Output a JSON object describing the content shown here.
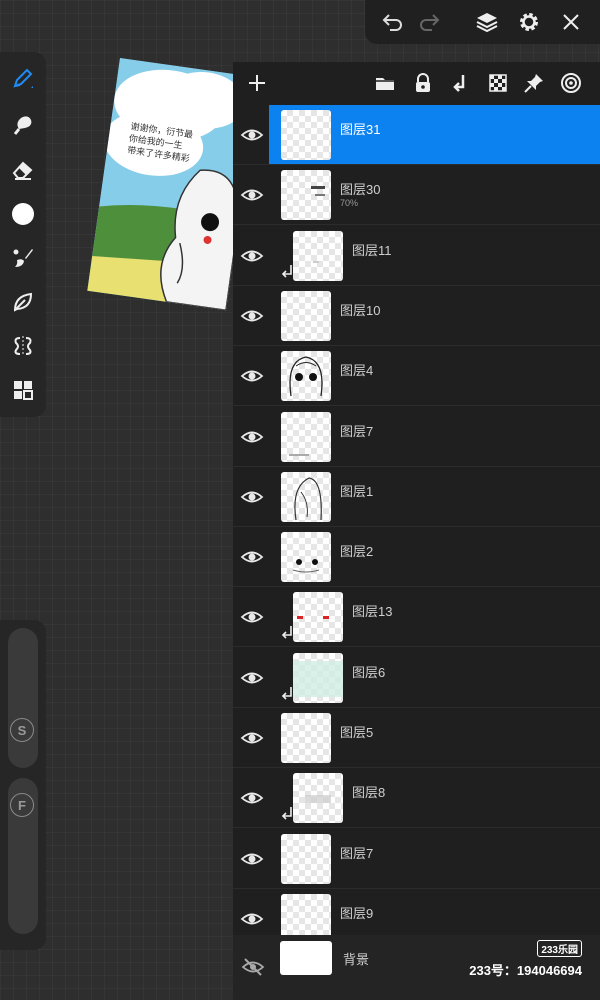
{
  "canvas": {
    "bubble_lines": [
      "谢谢你，衍节最",
      "你给我的一生",
      "带来了许多精彩"
    ]
  },
  "layers": [
    {
      "name": "图层31",
      "selected": true,
      "clipped": false,
      "opacity": ""
    },
    {
      "name": "图层30",
      "selected": false,
      "clipped": false,
      "opacity": "70%"
    },
    {
      "name": "图层11",
      "selected": false,
      "clipped": true,
      "opacity": ""
    },
    {
      "name": "图层10",
      "selected": false,
      "clipped": false,
      "opacity": ""
    },
    {
      "name": "图层4",
      "selected": false,
      "clipped": false,
      "opacity": ""
    },
    {
      "name": "图层7",
      "selected": false,
      "clipped": false,
      "opacity": ""
    },
    {
      "name": "图层1",
      "selected": false,
      "clipped": false,
      "opacity": ""
    },
    {
      "name": "图层2",
      "selected": false,
      "clipped": false,
      "opacity": ""
    },
    {
      "name": "图层13",
      "selected": false,
      "clipped": true,
      "opacity": ""
    },
    {
      "name": "图层6",
      "selected": false,
      "clipped": true,
      "opacity": ""
    },
    {
      "name": "图层5",
      "selected": false,
      "clipped": false,
      "opacity": ""
    },
    {
      "name": "图层8",
      "selected": false,
      "clipped": true,
      "opacity": ""
    },
    {
      "name": "图层7",
      "selected": false,
      "clipped": false,
      "opacity": ""
    },
    {
      "name": "图层9",
      "selected": false,
      "clipped": false,
      "opacity": ""
    }
  ],
  "background_layer": {
    "name": "背景",
    "visible": false
  },
  "watermark": {
    "logo": "233乐园",
    "id_text": "233号：194046694"
  },
  "toolbar": {
    "size_slider_label": "S",
    "flow_slider_label": "F"
  },
  "colors": {
    "accent": "#0b82f0",
    "panel": "#1f1f1f"
  },
  "icons": {
    "topbar": [
      "undo-icon",
      "redo-icon",
      "layers-icon",
      "settings-gear-icon",
      "close-icon"
    ],
    "panel_header": [
      "add-layer-icon",
      "folder-icon",
      "lock-icon",
      "merge-down-icon",
      "checkerboard-icon",
      "pin-icon",
      "target-icon"
    ],
    "tools": [
      "pen-icon",
      "smudge-icon",
      "eraser-icon",
      "color-circle-icon",
      "brush-icon",
      "leaf-icon",
      "symmetry-icon",
      "grid-icon"
    ]
  }
}
